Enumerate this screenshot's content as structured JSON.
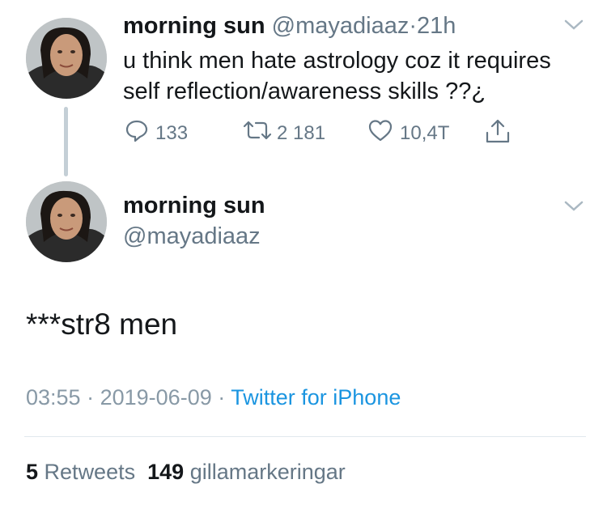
{
  "tweet1": {
    "display_name": "morning sun",
    "handle": "@mayadiaaz",
    "separator": "·",
    "time": "21h",
    "text_line1": "u think men hate astrology coz it requires",
    "text_line2": "self reflection/awareness skills ??¿",
    "replies": "133",
    "retweets": "2 181",
    "likes": "10,4T"
  },
  "tweet2": {
    "display_name": "morning sun",
    "handle": "@mayadiaaz",
    "text": "***str8 men",
    "time": "03:55",
    "sep1": "·",
    "date": "2019-06-09",
    "sep2": "·",
    "source": "Twitter for iPhone",
    "retweet_count": "5",
    "retweet_label": "Retweets",
    "like_count": "149",
    "like_label": "gillamarkeringar"
  },
  "icons": [
    "chevron-down-icon",
    "reply-icon",
    "retweet-icon",
    "heart-icon",
    "share-icon"
  ],
  "colors": {
    "link": "#1b95e0",
    "muted": "#657786",
    "line": "#c4cfd6"
  }
}
